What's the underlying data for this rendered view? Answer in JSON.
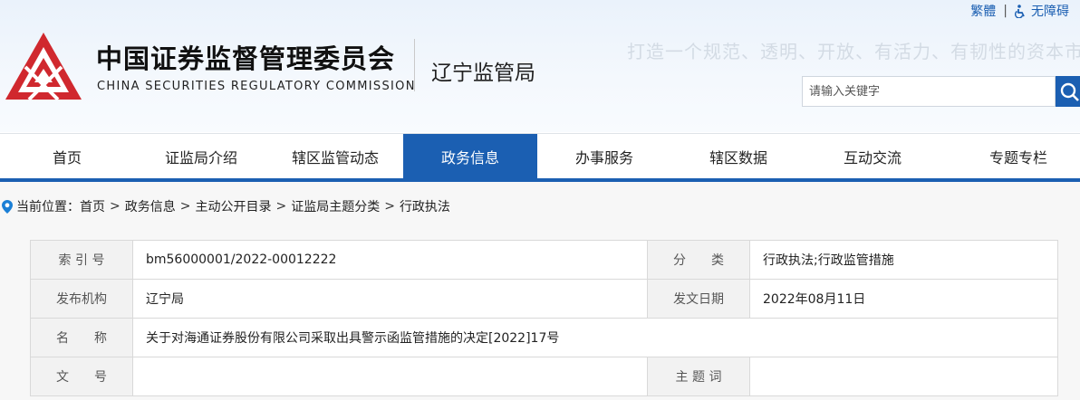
{
  "topbar": {
    "traditional": "繁體",
    "separator": "|",
    "accessibility": "无障碍"
  },
  "header": {
    "cn_title": "中国证券监督管理委员会",
    "en_title": "CHINA SECURITIES REGULATORY COMMISSION",
    "bureau": "辽宁监管局",
    "slogan": "打造一个规范、透明、开放、有活力、有韧性的资本市场",
    "logo_color": "#d0282e"
  },
  "search": {
    "placeholder": "请输入关键字"
  },
  "nav": {
    "items": [
      "首页",
      "证监局介绍",
      "辖区监管动态",
      "政务信息",
      "办事服务",
      "辖区数据",
      "互动交流",
      "专题专栏"
    ],
    "active": "政务信息",
    "accent": "#1b5fb2"
  },
  "breadcrumb": {
    "prefix": "当前位置：",
    "items": [
      "首页",
      "政务信息",
      "主动公开目录",
      "证监局主题分类",
      "行政执法"
    ],
    "sep": ">"
  },
  "info": {
    "index_label": "索 引 号",
    "index_value": "bm56000001/2022-00012222",
    "category_label": "分　　类",
    "category_value": "行政执法;行政监管措施",
    "publisher_label": "发布机构",
    "publisher_value": "辽宁局",
    "date_label": "发文日期",
    "date_value": "2022年08月11日",
    "name_label": "名　　称",
    "name_value": "关于对海通证券股份有限公司采取出具警示函监管措施的决定[2022]17号",
    "docno_label": "文　　号",
    "docno_value": "",
    "subject_label": "主 题 词",
    "subject_value": ""
  }
}
